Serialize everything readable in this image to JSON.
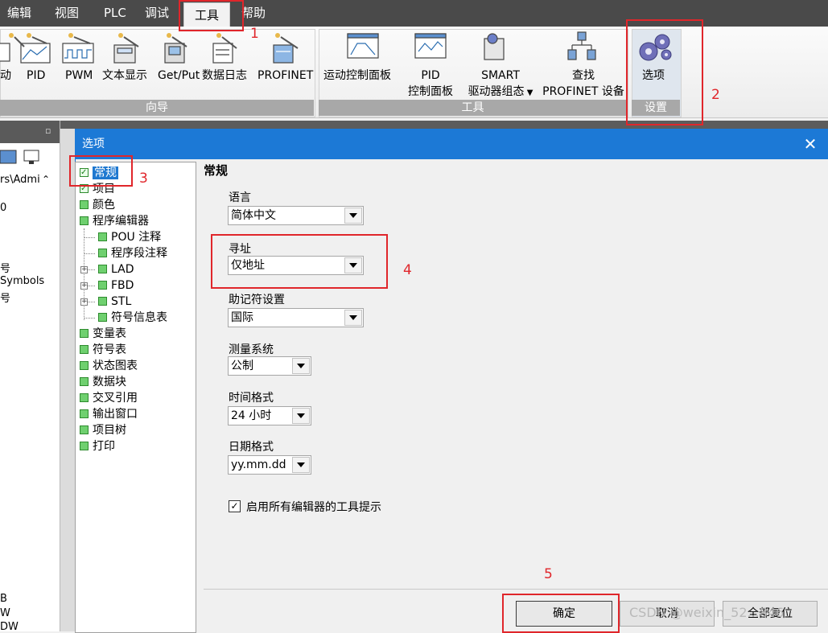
{
  "menubar": {
    "items": [
      "编辑",
      "视图",
      "PLC",
      "调试",
      "工具",
      "帮助"
    ],
    "active": "工具"
  },
  "ribbon": {
    "groups": [
      {
        "label": "向导"
      },
      {
        "label": "工具"
      },
      {
        "label": "设置"
      }
    ],
    "wizard_buttons": [
      "动",
      "PID",
      "PWM",
      "文本显示",
      "Get/Put",
      "数据日志",
      "PROFINET"
    ],
    "tool_buttons": [
      {
        "line1": "运动控制面板",
        "line2": ""
      },
      {
        "line1": "PID",
        "line2": "控制面板"
      },
      {
        "line1": "SMART",
        "line2": "驱动器组态"
      },
      {
        "line1": "查找",
        "line2": "PROFINET 设备"
      }
    ],
    "settings_button": "选项"
  },
  "left_pane": {
    "lines": [
      "rs\\Admi",
      "0",
      "号",
      "Symbols",
      "号",
      "B",
      "W",
      "DW"
    ]
  },
  "dialog": {
    "title": "选项",
    "close": "✕",
    "tree": [
      {
        "label": "常规",
        "checked": true,
        "selected": true
      },
      {
        "label": "项目",
        "checked": true
      },
      {
        "label": "颜色"
      },
      {
        "label": "程序编辑器"
      },
      {
        "label": "POU 注释"
      },
      {
        "label": "程序段注释"
      },
      {
        "label": "LAD"
      },
      {
        "label": "FBD"
      },
      {
        "label": "STL"
      },
      {
        "label": "符号信息表"
      },
      {
        "label": "变量表"
      },
      {
        "label": "符号表"
      },
      {
        "label": "状态图表"
      },
      {
        "label": "数据块"
      },
      {
        "label": "交叉引用"
      },
      {
        "label": "输出窗口"
      },
      {
        "label": "项目树"
      },
      {
        "label": "打印"
      }
    ],
    "section_title": "常规",
    "fields": {
      "language": {
        "label": "语言",
        "value": "简体中文"
      },
      "addressing": {
        "label": "寻址",
        "value": "仅地址"
      },
      "mnemonic": {
        "label": "助记符设置",
        "value": "国际"
      },
      "measure": {
        "label": "测量系统",
        "value": "公制"
      },
      "time_format": {
        "label": "时间格式",
        "value": "24 小时"
      },
      "date_format": {
        "label": "日期格式",
        "value": "yy.mm.dd"
      }
    },
    "tooltip_checkbox": {
      "label": "启用所有编辑器的工具提示",
      "checked": true
    },
    "buttons": {
      "ok": "确定",
      "cancel": "取消",
      "reset_all": "全部复位"
    }
  },
  "annotations": [
    "1",
    "2",
    "3",
    "4",
    "5"
  ],
  "watermark": "CSDN @weixin_52...846",
  "colors": {
    "annotation": "#e0262b",
    "title_bar": "#1c79d6",
    "selection": "#1e78d0"
  }
}
